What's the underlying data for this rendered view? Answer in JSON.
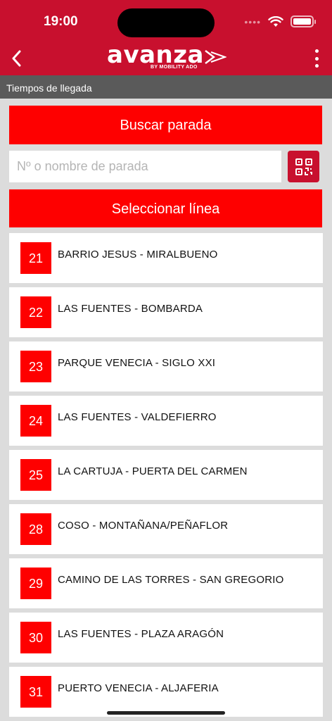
{
  "status_bar": {
    "time": "19:00",
    "signal_icon": "signal-dots-icon",
    "wifi_icon": "wifi-icon",
    "battery_icon": "battery-icon"
  },
  "header": {
    "back_icon": "chevron-left-icon",
    "logo_text": "avanza",
    "logo_subtitle": "BY MOBILITY ADO",
    "menu_icon": "more-vertical-icon"
  },
  "subheader": {
    "title": "Tiempos de llegada"
  },
  "search": {
    "button_label": "Buscar parada",
    "placeholder": "Nº o nombre de parada",
    "value": "",
    "qr_icon": "qr-code-icon"
  },
  "select_line": {
    "button_label": "Seleccionar línea"
  },
  "lines": [
    {
      "number": "21",
      "name": "BARRIO JESUS - MIRALBUENO"
    },
    {
      "number": "22",
      "name": "LAS FUENTES - BOMBARDA"
    },
    {
      "number": "23",
      "name": "PARQUE VENECIA - SIGLO XXI"
    },
    {
      "number": "24",
      "name": "LAS FUENTES - VALDEFIERRO"
    },
    {
      "number": "25",
      "name": "LA CARTUJA - PUERTA DEL CARMEN"
    },
    {
      "number": "28",
      "name": "COSO - MONTAÑANA/PEÑAFLOR"
    },
    {
      "number": "29",
      "name": "CAMINO DE LAS TORRES - SAN GREGORIO"
    },
    {
      "number": "30",
      "name": "LAS FUENTES - PLAZA ARAGÓN"
    },
    {
      "number": "31",
      "name": "PUERTO VENECIA - ALJAFERIA"
    }
  ],
  "colors": {
    "brand_red": "#c8102e",
    "accent_red": "#fe0000",
    "subheader_gray": "#5a5a5a",
    "background": "#dcdcdc"
  }
}
